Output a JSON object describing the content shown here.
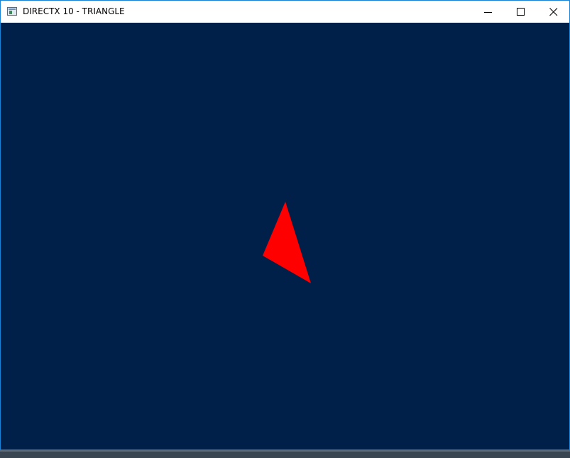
{
  "window": {
    "title": "DIRECTX 10 - TRIANGLE",
    "icon": "app-window-icon",
    "border_color": "#1883d7"
  },
  "controls": {
    "minimize_icon": "minimize-icon",
    "maximize_icon": "maximize-icon",
    "close_icon": "close-icon"
  },
  "scene": {
    "clear_color": "#00204a",
    "triangle_color": "#ff0000"
  }
}
